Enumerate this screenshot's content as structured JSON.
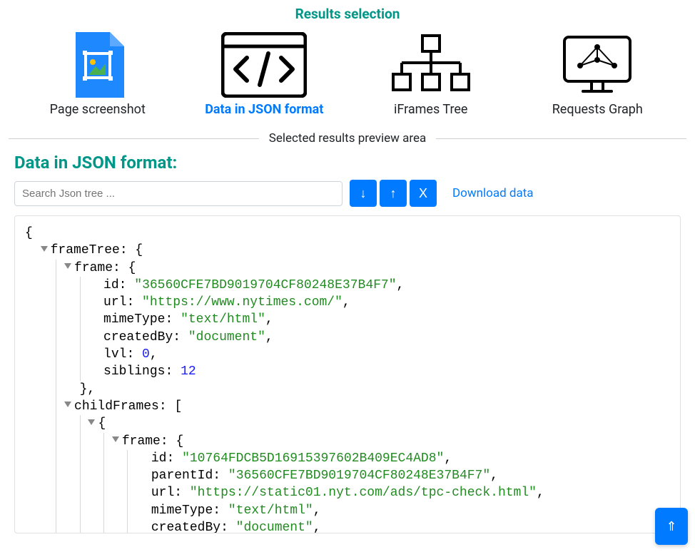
{
  "header": {
    "title": "Results selection"
  },
  "tabs": {
    "screenshot": {
      "label": "Page screenshot"
    },
    "json": {
      "label": "Data in JSON format",
      "active": true
    },
    "iframes": {
      "label": "iFrames Tree"
    },
    "requests": {
      "label": "Requests Graph"
    }
  },
  "divider": {
    "label": "Selected results preview area"
  },
  "section": {
    "title": "Data in JSON format:"
  },
  "toolbar": {
    "search_placeholder": "Search Json tree ...",
    "expand_label": "↓",
    "collapse_label": "↑",
    "clear_label": "X",
    "download_label": "Download data"
  },
  "json_tree": {
    "root_open": "{",
    "frameTree_key": "frameTree",
    "frame_key": "frame",
    "childFrames_key": "childFrames",
    "frame": {
      "id": "36560CFE7BD9019704CF80248E37B4F7",
      "url": "https://www.nytimes.com/",
      "mimeType": "text/html",
      "createdBy": "document",
      "lvl": "0",
      "siblings": "12"
    },
    "close_brace_comma": "},",
    "childFrames_open": "[",
    "child0_open": "{",
    "child0_frame": {
      "id": "10764FDCB5D16915397602B409EC4AD8",
      "parentId": "36560CFE7BD9019704CF80248E37B4F7",
      "url": "https://static01.nyt.com/ads/tpc-check.html",
      "mimeType": "text/html",
      "createdBy": "document"
    },
    "keys": {
      "id": "id",
      "url": "url",
      "mimeType": "mimeType",
      "createdBy": "createdBy",
      "lvl": "lvl",
      "siblings": "siblings",
      "parentId": "parentId"
    }
  },
  "scroll_top_label": "⇑"
}
